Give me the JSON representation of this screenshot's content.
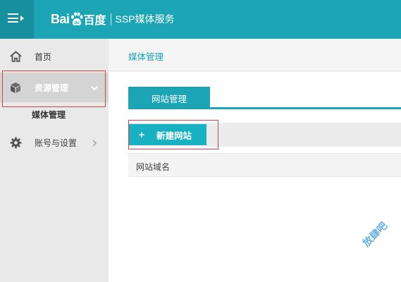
{
  "brand": {
    "logo_bai": "Bai",
    "logo_cn": "百度",
    "service_name": "SSP媒体服务",
    "color": "#1ba5b5"
  },
  "sidebar": {
    "items": [
      {
        "label": "首页",
        "icon": "home-icon"
      },
      {
        "label": "资源管理",
        "icon": "cube-icon",
        "expanded": true,
        "children": [
          {
            "label": "媒体管理"
          }
        ]
      },
      {
        "label": "账号与设置",
        "icon": "gear-icon"
      }
    ]
  },
  "main": {
    "page_title": "媒体管理",
    "tabs": [
      {
        "label": "网站管理",
        "active": true
      }
    ],
    "toolbar": {
      "new_button_plus": "+",
      "new_button_label": "新建网站"
    },
    "table": {
      "columns": [
        "网站域名"
      ]
    }
  },
  "watermark": "放肆吧",
  "colors": {
    "accent": "#1ba5b5",
    "highlight_border": "#c8454a"
  }
}
